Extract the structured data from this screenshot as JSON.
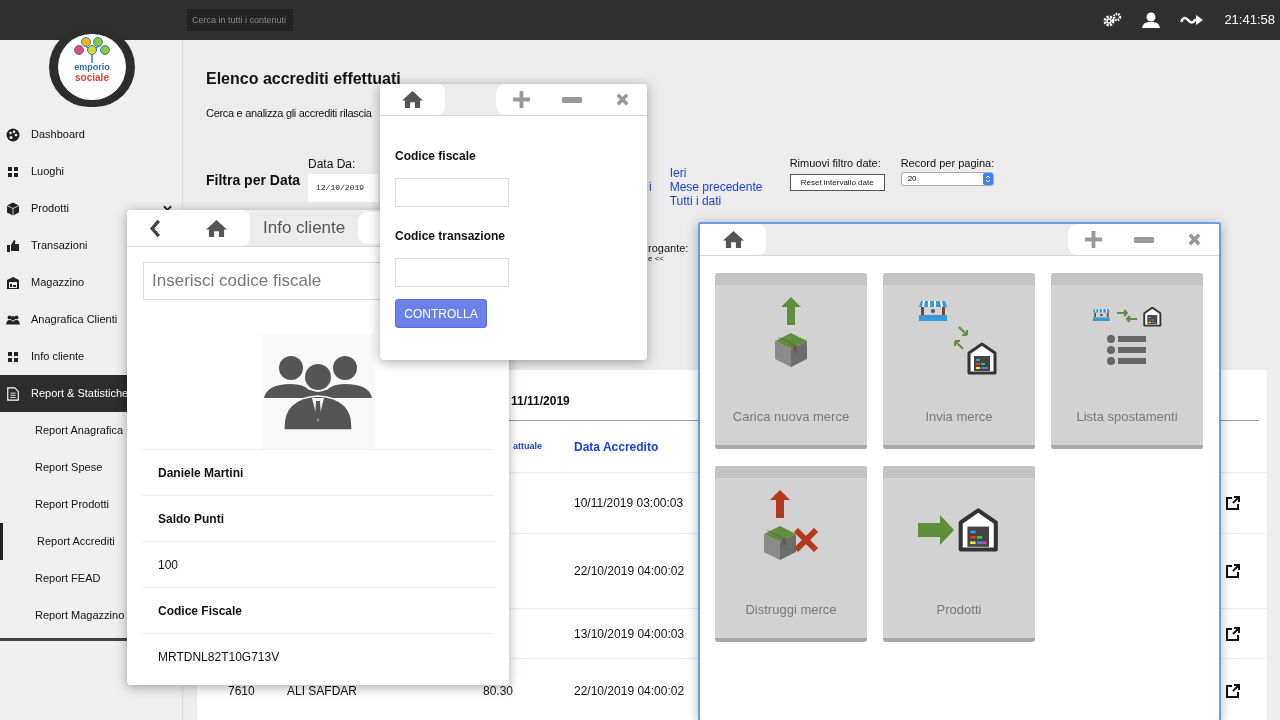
{
  "top_bar": {
    "search": {
      "placeholder": "Cerca in tutti i contenuti"
    },
    "time": "21:41:58"
  },
  "logo": {
    "line_1": "emporio",
    "line_2": "sociale"
  },
  "sidebar": {
    "items": [
      {
        "label": "Dashboard",
        "selected": false,
        "chevron": false
      },
      {
        "label": "Luoghi",
        "selected": false,
        "chevron": false
      },
      {
        "label": "Prodotti",
        "selected": false,
        "chevron": true
      },
      {
        "label": "Transazioni",
        "selected": false
      },
      {
        "label": "Magazzino",
        "selected": false
      },
      {
        "label": "Anagrafica Clienti",
        "selected": false
      },
      {
        "label": "Info cliente",
        "selected": false
      },
      {
        "label": "Report & Statistiche",
        "selected": true,
        "chevron": false,
        "children": [
          {
            "label": "Report Anagrafica",
            "selected": false
          },
          {
            "label": "Report Spese",
            "selected": false
          },
          {
            "label": "Report Prodotti",
            "selected": false
          },
          {
            "label": "Report Accrediti",
            "selected": true
          },
          {
            "label": "Report FEAD",
            "selected": false
          },
          {
            "label": "Report Magazzino",
            "selected": false
          }
        ]
      }
    ]
  },
  "main": {
    "title": "Elenco accrediti effettuati",
    "subtitle": "Cerca e analizza gli accrediti rilascia",
    "filter": {
      "label": "Filtra per Data",
      "date_from": {
        "label": "Data Da:",
        "value": "12/10/2019"
      },
      "quick_links_column_1": [
        "i"
      ],
      "quick_links_column_2": [
        "Ieri",
        "Mese precedente",
        "Tutti i dati"
      ],
      "reset": {
        "label": "Rimuovi filtro date:",
        "button": "Reset intervallo date"
      },
      "records": {
        "label": "Record per pagina:",
        "value": "20"
      }
    },
    "search_fragment": {
      "label": "rogante:",
      "value": "e <<"
    },
    "table": {
      "period": "11/11/2019",
      "columns": [
        "attuale",
        "Data Accredito"
      ],
      "rows": [
        {
          "date": "10/11/2019 03:00:03"
        },
        {
          "date": "22/10/2019 04:00:02"
        },
        {
          "date": "13/10/2019 04:00:03"
        },
        {
          "id": "7610",
          "name": "ALI SAFDAR",
          "amount": "80.30",
          "date": "22/10/2019 04:00:02"
        }
      ]
    }
  },
  "info_window": {
    "title": "Info cliente",
    "search": {
      "placeholder": "Inserisci codice fiscale"
    },
    "rows": [
      {
        "text": "Daniele Martini",
        "bold": true
      },
      {
        "text": "Saldo Punti",
        "bold": true
      },
      {
        "text": "100",
        "bold": false
      },
      {
        "text": "Codice Fiscale",
        "bold": true
      },
      {
        "text": "MRTDNL82T10G713V",
        "bold": false
      }
    ]
  },
  "code_window": {
    "fields": [
      {
        "label": "Codice fiscale"
      },
      {
        "label": "Codice transazione"
      }
    ],
    "button": "CONTROLLA"
  },
  "warehouse_window": {
    "tiles": [
      {
        "label": "Carica nuova merce"
      },
      {
        "label": "Invia merce"
      },
      {
        "label": "Lista spostamenti"
      },
      {
        "label": "Distruggi merce"
      },
      {
        "label": "Prodotti"
      }
    ]
  }
}
